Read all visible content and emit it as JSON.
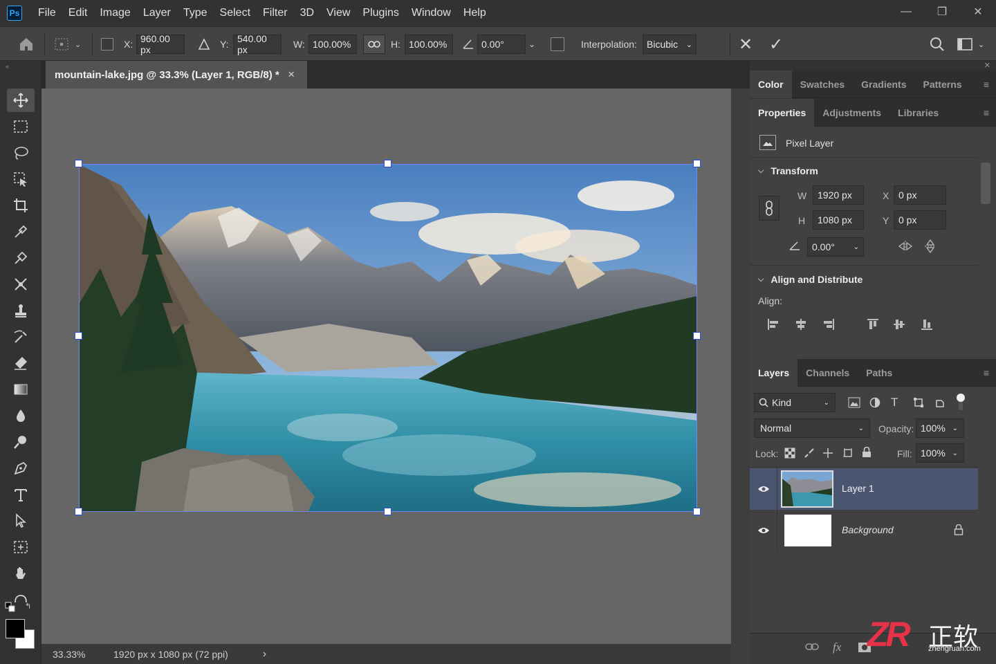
{
  "app": {
    "logo": "Ps"
  },
  "menu": [
    "File",
    "Edit",
    "Image",
    "Layer",
    "Type",
    "Select",
    "Filter",
    "3D",
    "View",
    "Plugins",
    "Window",
    "Help"
  ],
  "window_controls": {
    "minimize": "—",
    "restore": "❐",
    "close": "✕"
  },
  "options": {
    "x_label": "X:",
    "x_value": "960.00 px",
    "y_label": "Y:",
    "y_value": "540.00 px",
    "w_label": "W:",
    "w_value": "100.00%",
    "h_label": "H:",
    "h_value": "100.00%",
    "angle_value": "0.00°",
    "interp_label": "Interpolation:",
    "interp_value": "Bicubic",
    "cancel": "✕",
    "commit": "✓"
  },
  "document": {
    "tab_title": "mountain-lake.jpg @ 33.3% (Layer 1, RGB/8) *",
    "close": "✕",
    "zoom": "33.33%",
    "info": "1920 px x 1080 px (72 ppi)",
    "info_arrow": "›"
  },
  "panels": {
    "top_tabs": [
      "Color",
      "Swatches",
      "Gradients",
      "Patterns"
    ],
    "prop_tabs": [
      "Properties",
      "Adjustments",
      "Libraries"
    ],
    "layer_type": "Pixel Layer",
    "transform": {
      "title": "Transform",
      "w_label": "W",
      "w_value": "1920 px",
      "h_label": "H",
      "h_value": "1080 px",
      "x_label": "X",
      "x_value": "0 px",
      "y_label": "Y",
      "y_value": "0 px",
      "angle_value": "0.00°"
    },
    "align": {
      "title": "Align and Distribute",
      "label": "Align:"
    },
    "layers_tabs": [
      "Layers",
      "Channels",
      "Paths"
    ],
    "kind": "Kind",
    "blend_mode": "Normal",
    "opacity_label": "Opacity:",
    "opacity_value": "100%",
    "lock_label": "Lock:",
    "fill_label": "Fill:",
    "fill_value": "100%",
    "layers": [
      {
        "name": "Layer 1",
        "selected": true
      },
      {
        "name": "Background",
        "selected": false
      }
    ],
    "bottom_icons": [
      "link-icon",
      "fx-icon",
      "mask-icon",
      "adjustment-icon",
      "group-icon",
      "new-layer-icon",
      "trash-icon"
    ]
  },
  "watermark": {
    "main": "ZR",
    "cn": "正软",
    "url": "zhengruan.com"
  },
  "colors": {
    "accent": "#31a8ff",
    "selection": "#4a5670",
    "handle_border": "#3050e0"
  }
}
